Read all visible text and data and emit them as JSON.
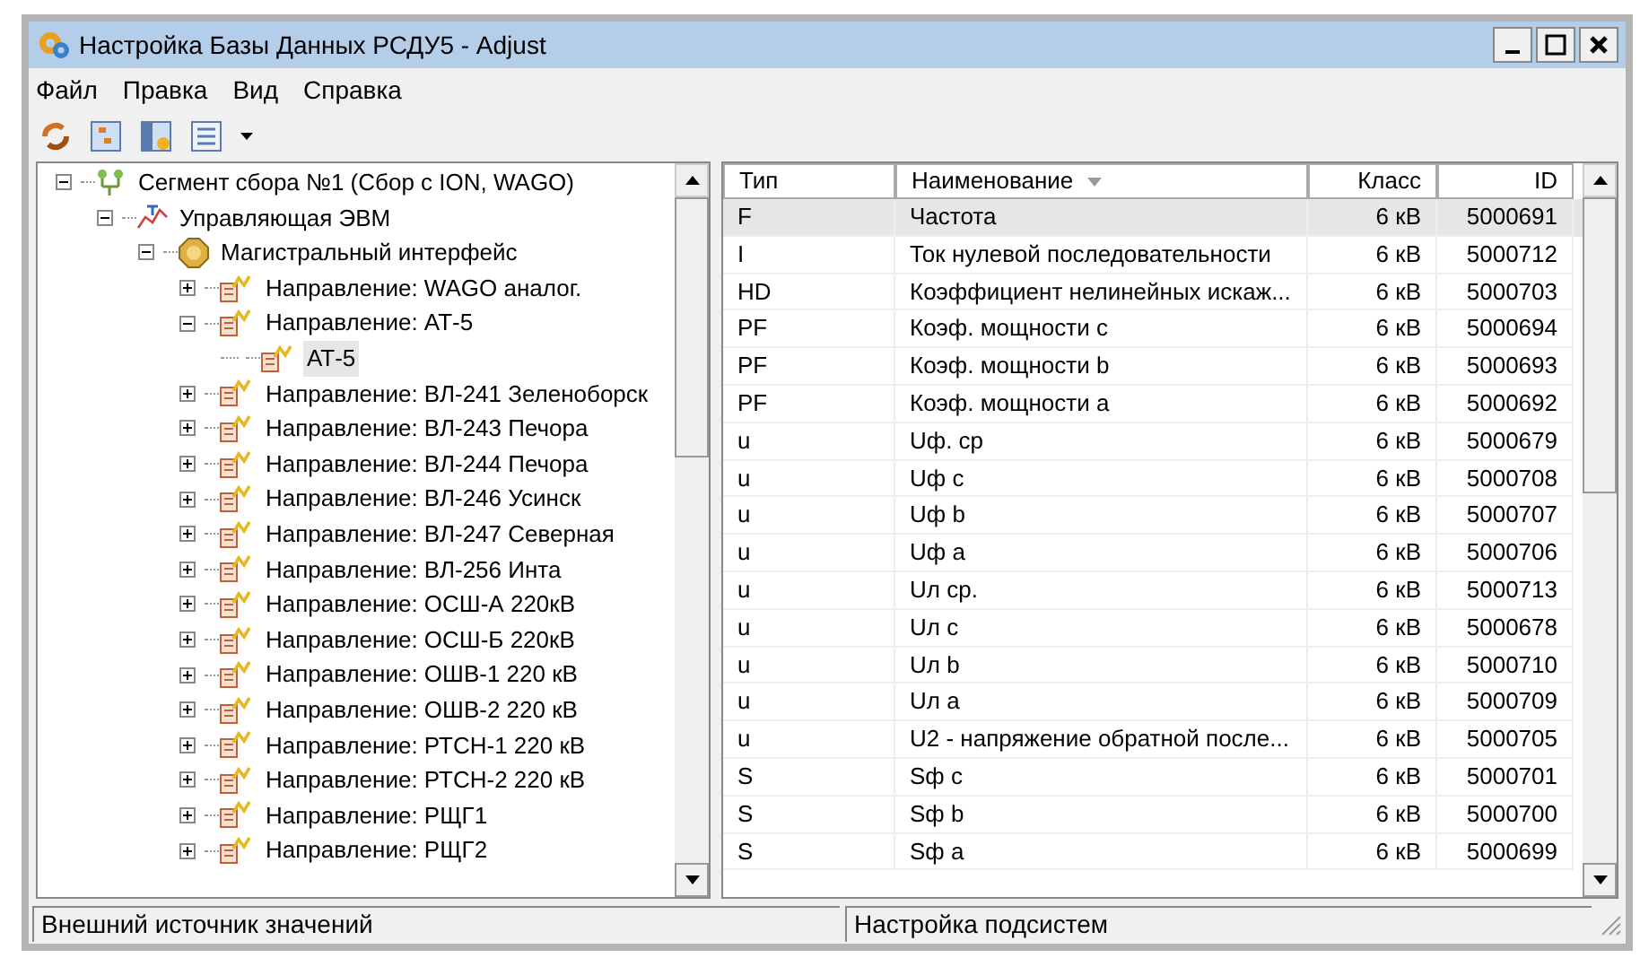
{
  "window": {
    "title": "Настройка Базы Данных РСДУ5 - Adjust"
  },
  "menu": [
    "Файл",
    "Правка",
    "Вид",
    "Справка"
  ],
  "tree": [
    {
      "label": "Сегмент сбора №1 (Сбор с ION, WAGO)",
      "kind": "segment",
      "expanded": true,
      "selected": false,
      "children": [
        {
          "label": "Управляющая ЭВМ",
          "kind": "computer",
          "expanded": true,
          "selected": false,
          "children": [
            {
              "label": "Магистральный интерфейс",
              "kind": "interface",
              "expanded": true,
              "selected": false,
              "children": [
                {
                  "label": "Направление: WAGO аналог.",
                  "kind": "direction",
                  "expanded": false,
                  "selected": false
                },
                {
                  "label": "Направление: АТ-5",
                  "kind": "direction",
                  "expanded": true,
                  "selected": false,
                  "children": [
                    {
                      "label": "АТ-5",
                      "kind": "direction",
                      "selected": true
                    }
                  ]
                },
                {
                  "label": "Направление: ВЛ-241 Зеленоборск",
                  "kind": "direction",
                  "expanded": false,
                  "selected": false
                },
                {
                  "label": "Направление: ВЛ-243 Печора",
                  "kind": "direction",
                  "expanded": false,
                  "selected": false
                },
                {
                  "label": "Направление: ВЛ-244 Печора",
                  "kind": "direction",
                  "expanded": false,
                  "selected": false
                },
                {
                  "label": "Направление: ВЛ-246 Усинск",
                  "kind": "direction",
                  "expanded": false,
                  "selected": false
                },
                {
                  "label": "Направление: ВЛ-247 Северная",
                  "kind": "direction",
                  "expanded": false,
                  "selected": false
                },
                {
                  "label": "Направление: ВЛ-256 Инта",
                  "kind": "direction",
                  "expanded": false,
                  "selected": false
                },
                {
                  "label": "Направление: ОСШ-А 220кВ",
                  "kind": "direction",
                  "expanded": false,
                  "selected": false
                },
                {
                  "label": "Направление: ОСШ-Б 220кВ",
                  "kind": "direction",
                  "expanded": false,
                  "selected": false
                },
                {
                  "label": "Направление: ОШВ-1 220 кВ",
                  "kind": "direction",
                  "expanded": false,
                  "selected": false
                },
                {
                  "label": "Направление: ОШВ-2 220 кВ",
                  "kind": "direction",
                  "expanded": false,
                  "selected": false
                },
                {
                  "label": "Направление: РТСН-1 220 кВ",
                  "kind": "direction",
                  "expanded": false,
                  "selected": false
                },
                {
                  "label": "Направление: РТСН-2 220 кВ",
                  "kind": "direction",
                  "expanded": false,
                  "selected": false
                },
                {
                  "label": "Направление: РЩГ1",
                  "kind": "direction",
                  "expanded": false,
                  "selected": false
                },
                {
                  "label": "Направление: РЩГ2",
                  "kind": "direction",
                  "expanded": false,
                  "selected": false
                }
              ]
            }
          ]
        }
      ]
    }
  ],
  "table": {
    "columns": [
      {
        "label": "Тип",
        "sorted": false
      },
      {
        "label": "Наименование",
        "sorted": true
      },
      {
        "label": "Класс",
        "sorted": false
      },
      {
        "label": "ID",
        "sorted": false
      }
    ],
    "rows": [
      {
        "cells": [
          "F",
          "Частота",
          "6 кВ",
          "5000691"
        ],
        "selected": true
      },
      {
        "cells": [
          "I",
          "Ток нулевой последовательности",
          "6 кВ",
          "5000712"
        ],
        "selected": false
      },
      {
        "cells": [
          "HD",
          "Коэффициент нелинейных искаж...",
          "6 кВ",
          "5000703"
        ],
        "selected": false
      },
      {
        "cells": [
          "PF",
          "Коэф. мощности с",
          "6 кВ",
          "5000694"
        ],
        "selected": false
      },
      {
        "cells": [
          "PF",
          "Коэф. мощности b",
          "6 кВ",
          "5000693"
        ],
        "selected": false
      },
      {
        "cells": [
          "PF",
          "Коэф. мощности а",
          "6 кВ",
          "5000692"
        ],
        "selected": false
      },
      {
        "cells": [
          "u",
          "Uф. ср",
          "6 кВ",
          "5000679"
        ],
        "selected": false
      },
      {
        "cells": [
          "u",
          "Uф с",
          "6 кВ",
          "5000708"
        ],
        "selected": false
      },
      {
        "cells": [
          "u",
          "Uф b",
          "6 кВ",
          "5000707"
        ],
        "selected": false
      },
      {
        "cells": [
          "u",
          "Uф а",
          "6 кВ",
          "5000706"
        ],
        "selected": false
      },
      {
        "cells": [
          "u",
          "Uл ср.",
          "6 кВ",
          "5000713"
        ],
        "selected": false
      },
      {
        "cells": [
          "u",
          "Uл с",
          "6 кВ",
          "5000678"
        ],
        "selected": false
      },
      {
        "cells": [
          "u",
          "Uл b",
          "6 кВ",
          "5000710"
        ],
        "selected": false
      },
      {
        "cells": [
          "u",
          "Uл а",
          "6 кВ",
          "5000709"
        ],
        "selected": false
      },
      {
        "cells": [
          "u",
          "U2 - напряжение обратной после...",
          "6 кВ",
          "5000705"
        ],
        "selected": false
      },
      {
        "cells": [
          "S",
          "Sф с",
          "6 кВ",
          "5000701"
        ],
        "selected": false
      },
      {
        "cells": [
          "S",
          "Sф b",
          "6 кВ",
          "5000700"
        ],
        "selected": false
      },
      {
        "cells": [
          "S",
          "Sф а",
          "6 кВ",
          "5000699"
        ],
        "selected": false
      }
    ]
  },
  "status_bar": [
    "Внешний источник значений",
    "Настройка подсистем"
  ]
}
